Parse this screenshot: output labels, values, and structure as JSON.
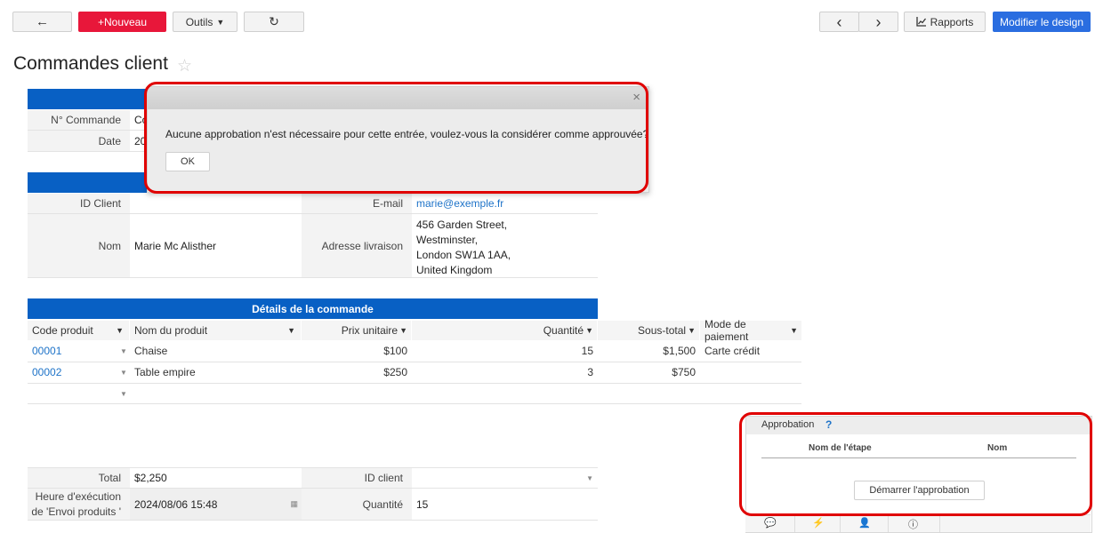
{
  "toolbar": {
    "back": "←",
    "new_label": "+Nouveau",
    "tools_label": "Outils",
    "refresh": "↻",
    "prev": "‹",
    "next": "›",
    "reports_label": "Rapports",
    "design_label": "Modifier le design"
  },
  "page_title": "Commandes client",
  "order": {
    "num_label": "N° Commande",
    "num_value": "Co",
    "date_label": "Date",
    "date_value": "20"
  },
  "client": {
    "id_label": "ID Client",
    "id_value": "",
    "email_label": "E-mail",
    "email_value": "marie@exemple.fr",
    "name_label": "Nom",
    "name_value": "Marie Mc Alisther",
    "address_label": "Adresse livraison",
    "address_lines": [
      "456 Garden Street,",
      "Westminster,",
      "London SW1A 1AA,",
      "United Kingdom"
    ]
  },
  "details": {
    "section_title": "Détails de la commande",
    "columns": [
      "Code produit",
      "Nom du produit",
      "Prix unitaire",
      "Quantité",
      "Sous-total",
      "Mode de paiement"
    ],
    "rows": [
      {
        "code": "00001",
        "name": "Chaise",
        "price": "$100",
        "qty": "15",
        "subtotal": "$1,500",
        "payment": "Carte crédit"
      },
      {
        "code": "00002",
        "name": "Table empire",
        "price": "$250",
        "qty": "3",
        "subtotal": "$750",
        "payment": ""
      }
    ]
  },
  "summary": {
    "total_label": "Total",
    "total_value": "$2,250",
    "client_id_label": "ID client",
    "client_id_value": "",
    "exec_label_1": "Heure d'exécution",
    "exec_label_2": "de 'Envoi produits '",
    "exec_value": "2024/08/06 15:48",
    "qty_label": "Quantité",
    "qty_value": "15"
  },
  "dialog": {
    "close": "×",
    "message": "Aucune approbation n'est nécessaire pour cette entrée, voulez-vous la considérer comme approuvée?",
    "ok_label": "OK"
  },
  "approval": {
    "title": "Approbation",
    "help": "?",
    "col_step": "Nom de l'étape",
    "col_name": "Nom",
    "start_label": "Démarrer l'approbation"
  },
  "colors": {
    "accent_blue": "#0860c4",
    "new_red": "#e8173a",
    "highlight_red": "#e00000"
  }
}
